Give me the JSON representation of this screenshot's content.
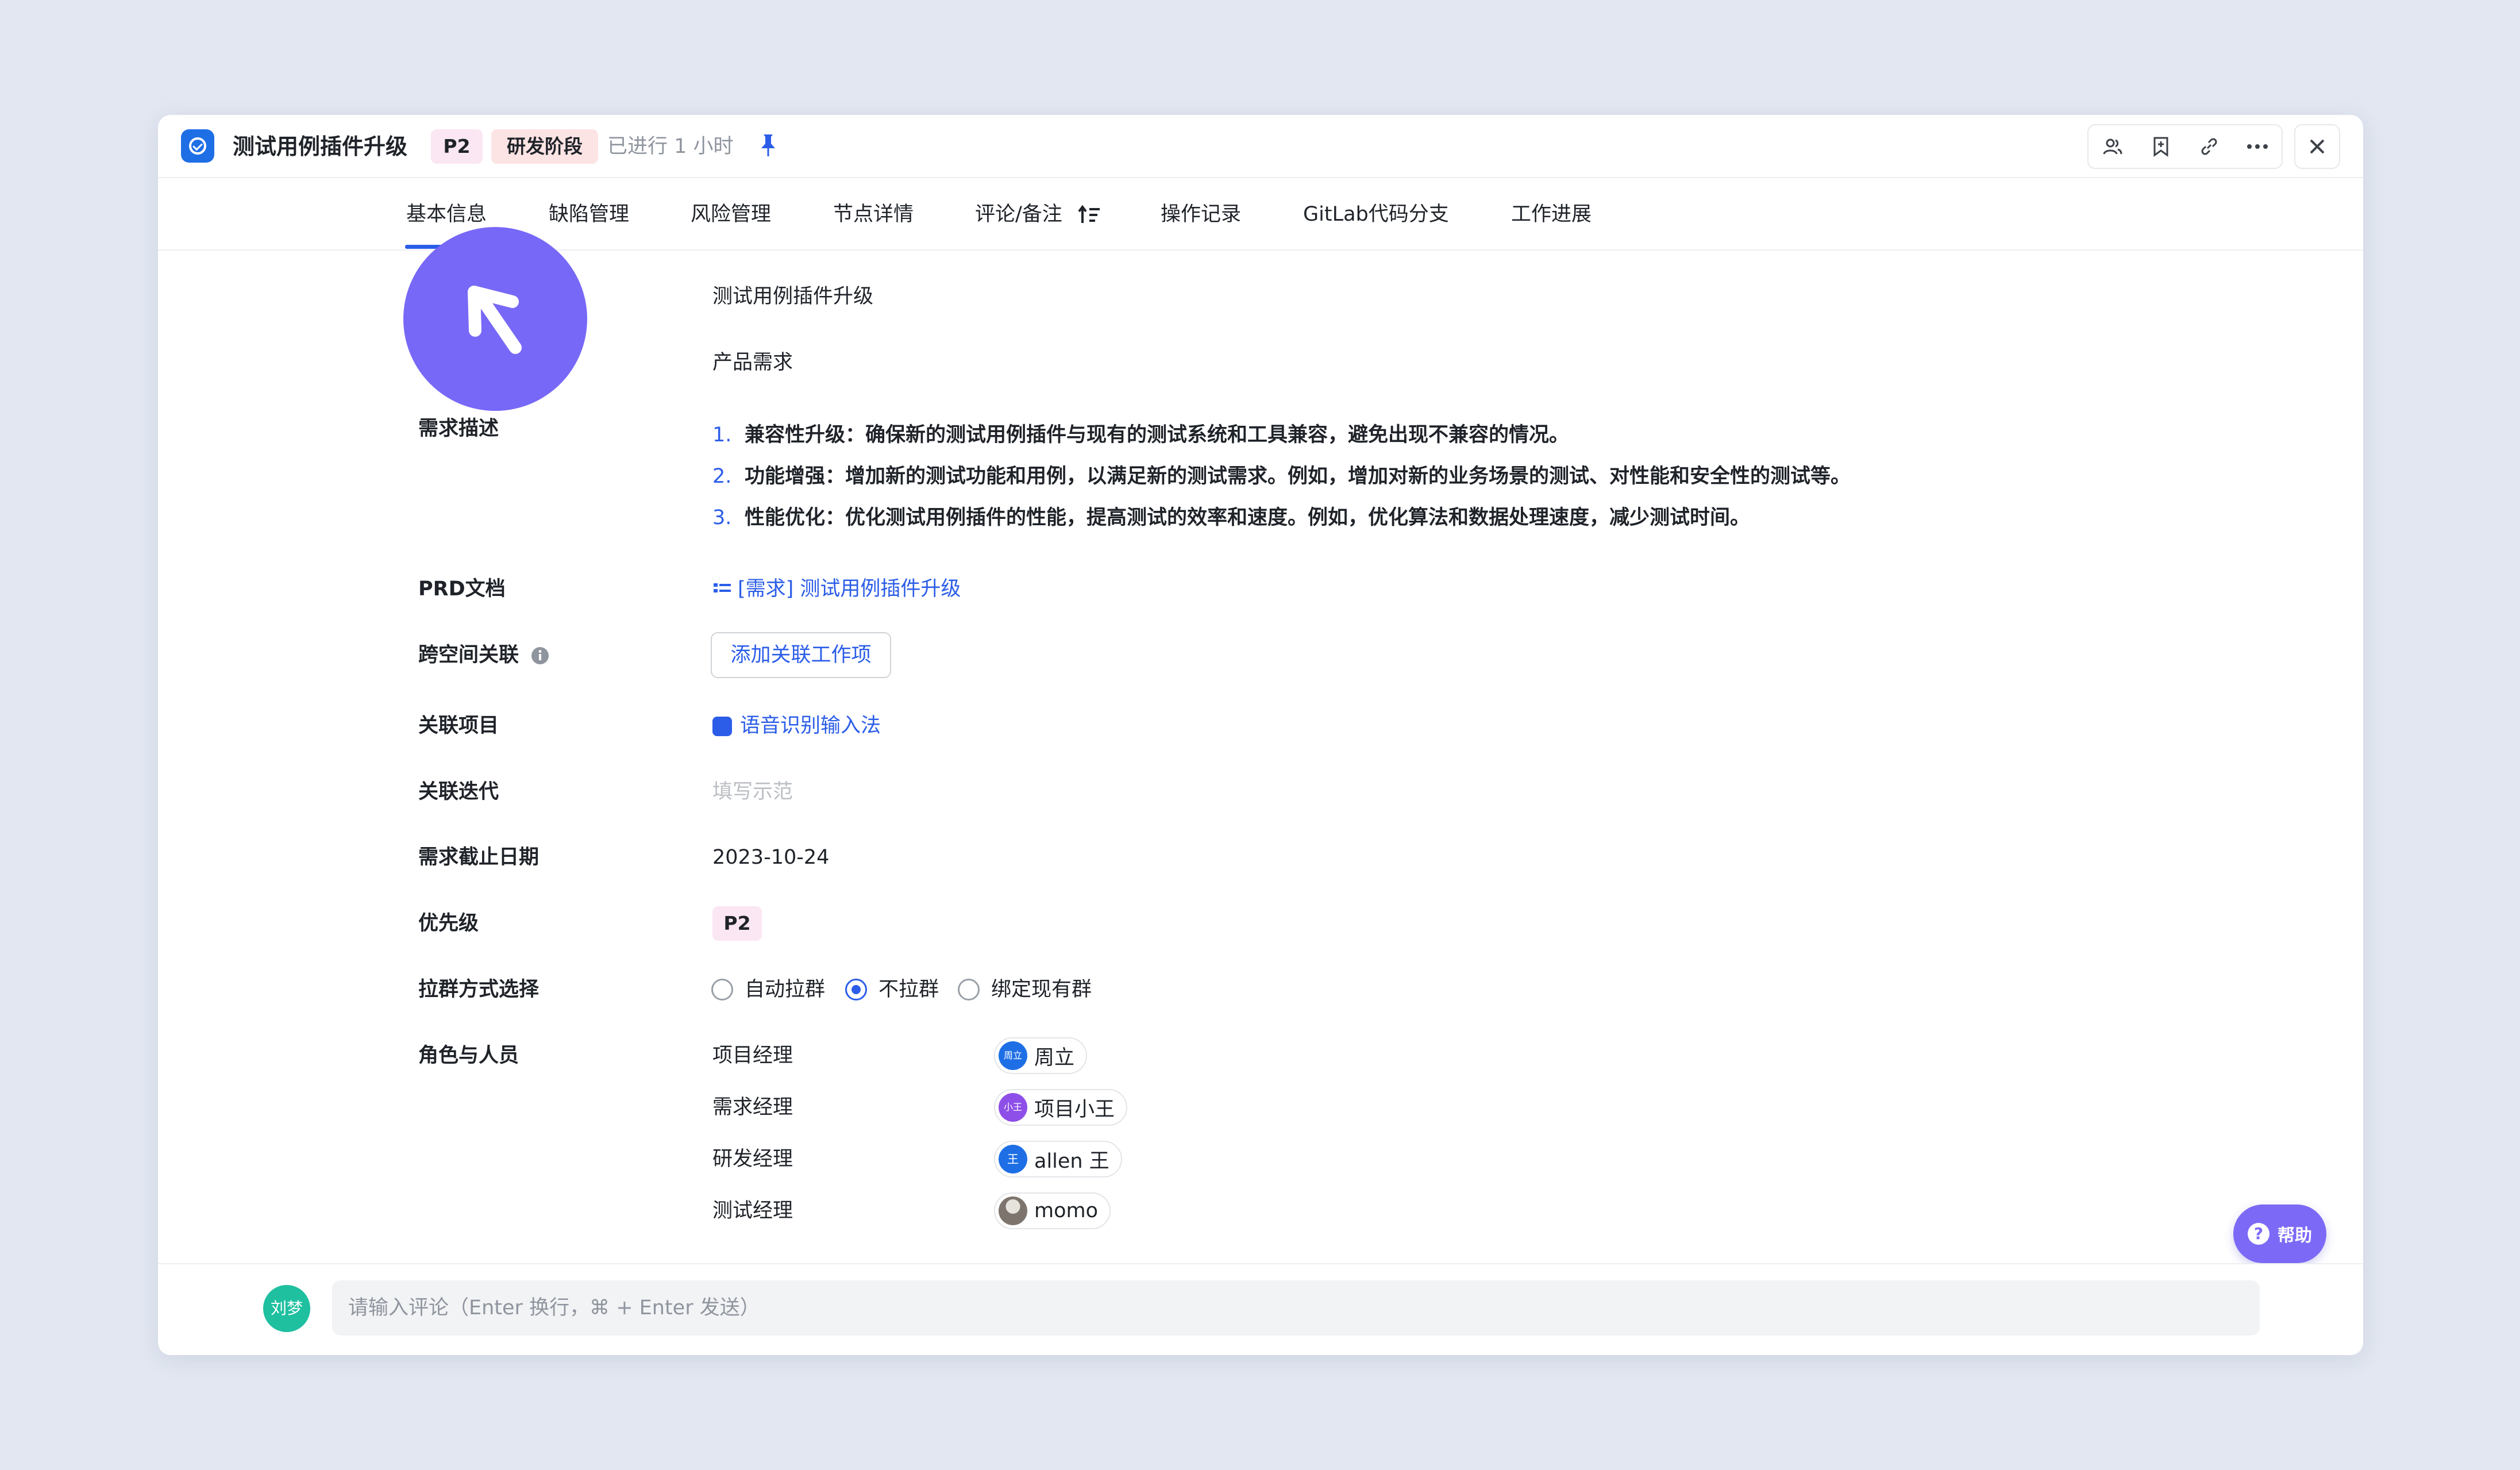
{
  "header": {
    "title": "测试用例插件升级",
    "priority_tag": "P2",
    "stage_tag": "研发阶段",
    "elapsed": "已进行 1 小时",
    "tools": [
      "members-icon",
      "bookmark-icon",
      "link-icon",
      "more-icon"
    ]
  },
  "tabs": [
    "基本信息",
    "缺陷管理",
    "风险管理",
    "节点详情",
    "评论/备注",
    "操作记录",
    "GitLab代码分支",
    "工作进展"
  ],
  "fields": {
    "name_value": "测试用例插件升级",
    "type_value": "产品需求",
    "desc_label": "需求描述",
    "desc_items": [
      {
        "num": "1.",
        "text": "兼容性升级：确保新的测试用例插件与现有的测试系统和工具兼容，避免出现不兼容的情况。"
      },
      {
        "num": "2.",
        "text": "功能增强：增加新的测试功能和用例，以满足新的测试需求。例如，增加对新的业务场景的测试、对性能和安全性的测试等。"
      },
      {
        "num": "3.",
        "text": "性能优化：优化测试用例插件的性能，提高测试的效率和速度。例如，优化算法和数据处理速度，减少测试时间。"
      }
    ],
    "prd_label": "PRD文档",
    "prd_value": "[需求] 测试用例插件升级",
    "cross_label": "跨空间关联",
    "cross_button": "添加关联工作项",
    "project_label": "关联项目",
    "project_value": "语音识别输入法",
    "iteration_label": "关联迭代",
    "iteration_placeholder": "填写示范",
    "deadline_label": "需求截止日期",
    "deadline_value": "2023-10-24",
    "priority_label": "优先级",
    "priority_value": "P2",
    "group_label": "拉群方式选择",
    "group_options": [
      "自动拉群",
      "不拉群",
      "绑定现有群"
    ],
    "group_selected": "不拉群",
    "roles_label": "角色与人员",
    "roles": [
      {
        "role": "项目经理",
        "avatar": "周立",
        "name": "周立"
      },
      {
        "role": "需求经理",
        "avatar": "小王",
        "name": "项目小王"
      },
      {
        "role": "研发经理",
        "avatar": "王",
        "name": "allen 王"
      },
      {
        "role": "测试经理",
        "avatar": "",
        "name": "momo"
      }
    ]
  },
  "help": {
    "label": "帮助"
  },
  "footer": {
    "avatar": "刘梦",
    "comment_placeholder": "请输入评论（Enter 换行，⌘ + Enter 发送）"
  },
  "colors": {
    "accent": "#2b5de8",
    "overlay": "#7768f7",
    "help": "#7c6af6"
  }
}
